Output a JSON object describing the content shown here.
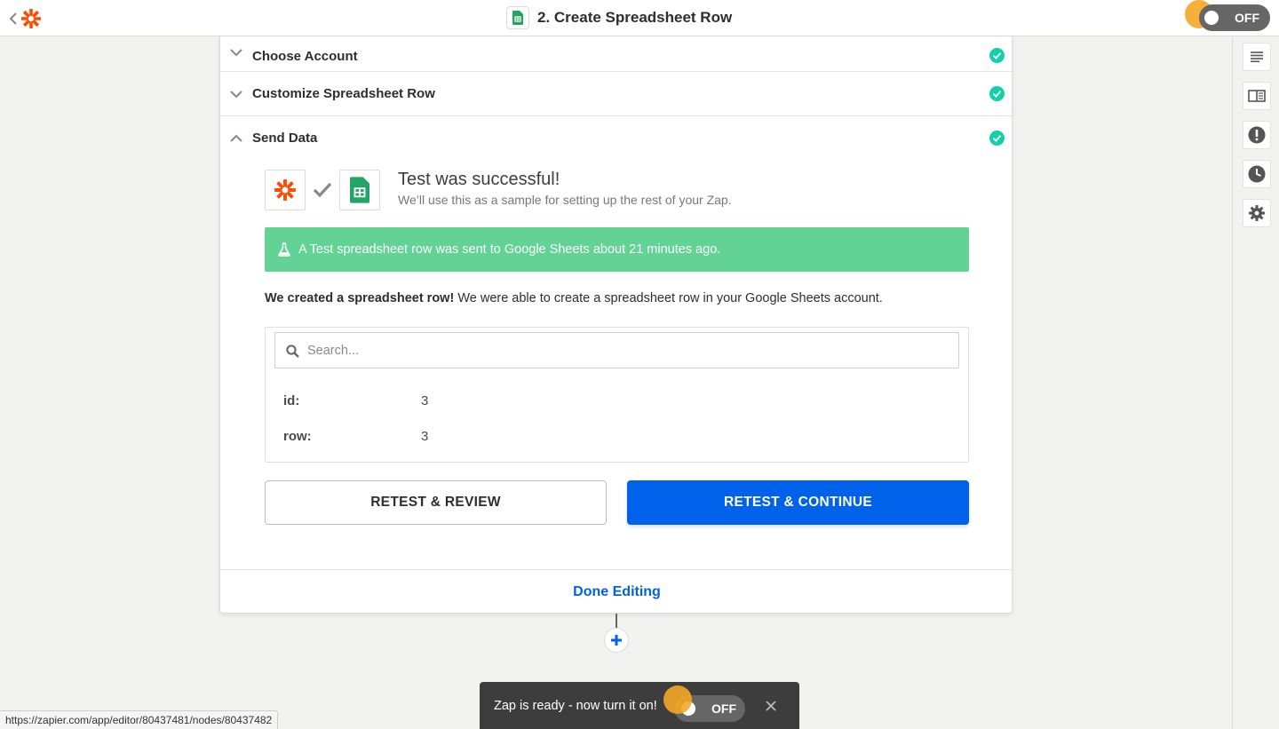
{
  "header": {
    "title": "2. Create Spreadsheet Row",
    "toggle_label": "OFF"
  },
  "colors": {
    "brand": "#ff4a00",
    "primary": "#0061ea",
    "success": "#62d394",
    "check": "#13d0ab",
    "sheets": "#23a566",
    "pulse": "#f5a623"
  },
  "icons": {
    "back": "chevron-left-icon",
    "logo": "zapier-logo-icon",
    "sheets": "google-sheets-icon",
    "sidebar": [
      "outline-icon",
      "guide-icon",
      "alert-icon",
      "history-icon",
      "gear-icon"
    ]
  },
  "sections": [
    {
      "label": "Choose Account",
      "expanded": false,
      "complete": true
    },
    {
      "label": "Customize Spreadsheet Row",
      "expanded": false,
      "complete": true
    },
    {
      "label": "Send Data",
      "expanded": true,
      "complete": true
    }
  ],
  "test": {
    "title": "Test was successful!",
    "subtitle": "We’ll use this as a sample for setting up the rest of your Zap.",
    "banner": "A Test spreadsheet row was sent to Google Sheets about 21 minutes ago.",
    "created_bold": "We created a spreadsheet row!",
    "created_rest": " We were able to create a spreadsheet row in your Google Sheets account."
  },
  "search": {
    "placeholder": "Search...",
    "value": ""
  },
  "fields": [
    {
      "key": "id:",
      "value": "3"
    },
    {
      "key": "row:",
      "value": "3"
    }
  ],
  "buttons": {
    "retest_review": "RETEST & REVIEW",
    "retest_continue": "RETEST & CONTINUE",
    "done_editing": "Done Editing"
  },
  "toast": {
    "message": "Zap is ready - now turn it on!",
    "toggle_label": "OFF"
  },
  "status_bar": {
    "url": "https://zapier.com/app/editor/80437481/nodes/80437482"
  }
}
